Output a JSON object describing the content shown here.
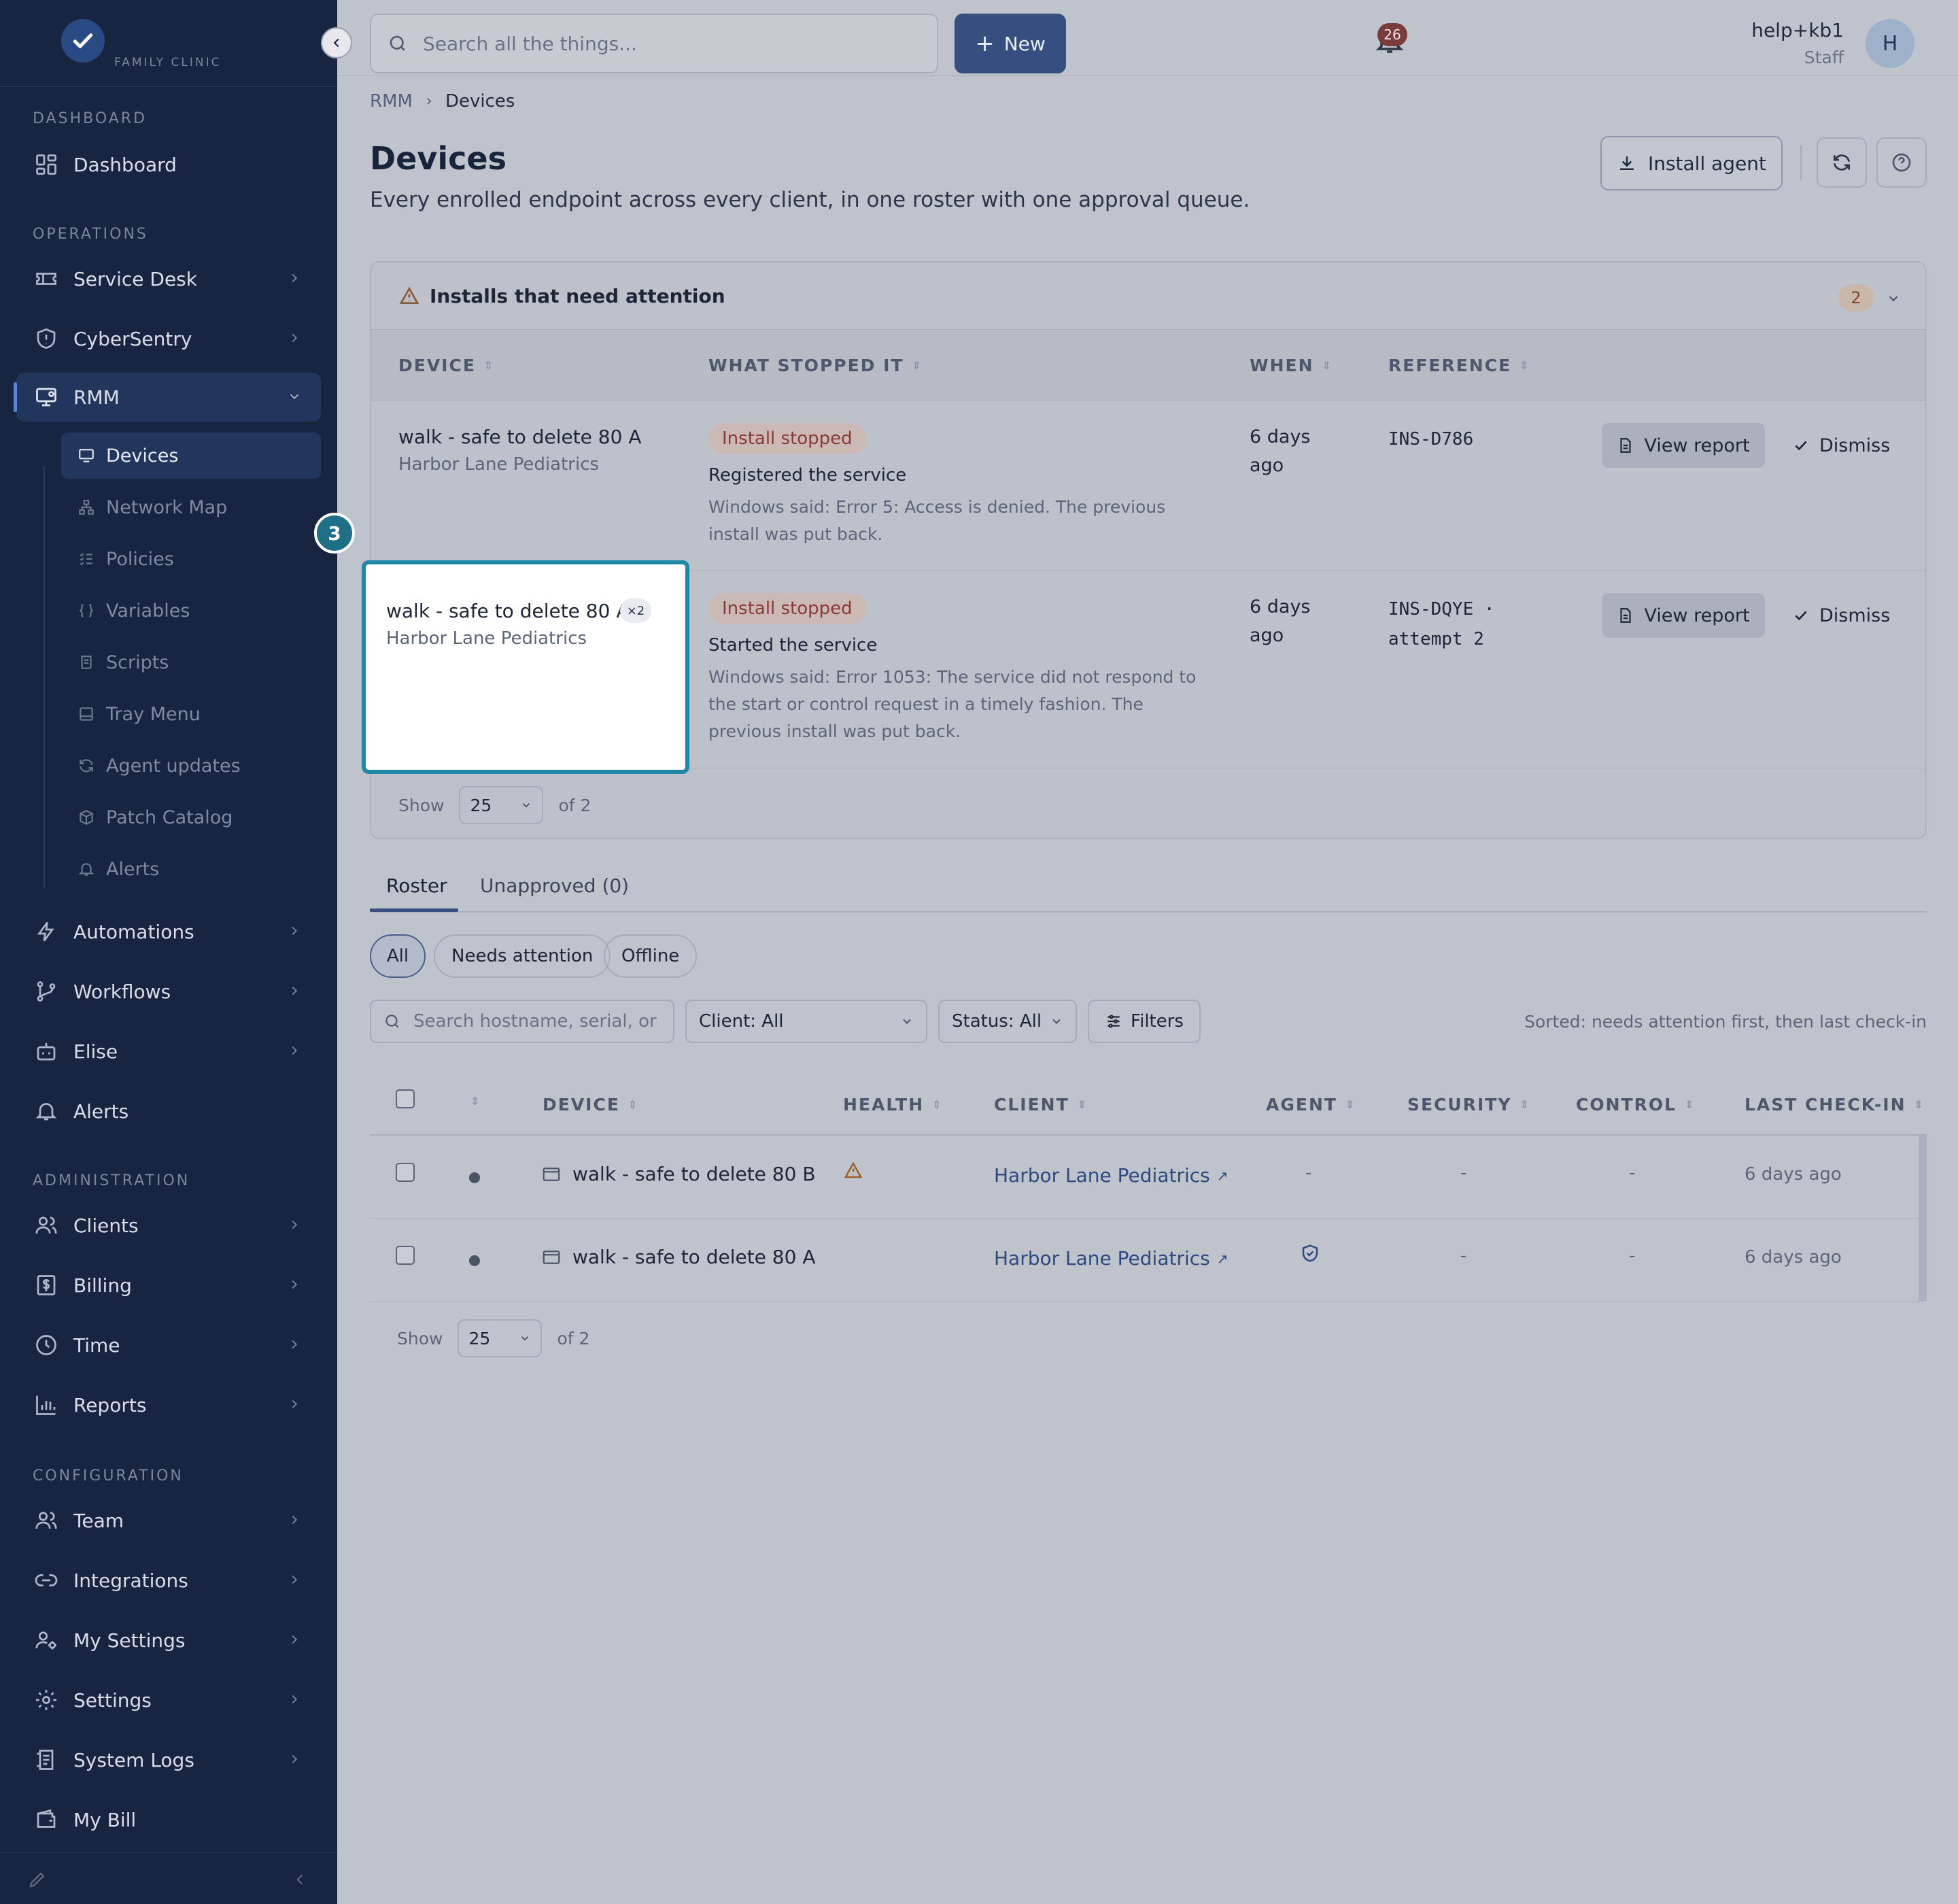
{
  "brand": {
    "name": "FAMILY CLINIC"
  },
  "sidebar": {
    "sections": {
      "dashboard": "DASHBOARD",
      "operations": "OPERATIONS",
      "administration": "ADMINISTRATION",
      "configuration": "CONFIGURATION"
    },
    "items": {
      "dashboard": "Dashboard",
      "service_desk": "Service Desk",
      "cybersentry": "CyberSentry",
      "rmm": "RMM",
      "automations": "Automations",
      "workflows": "Workflows",
      "elise": "Elise",
      "alerts": "Alerts",
      "clients": "Clients",
      "billing": "Billing",
      "time": "Time",
      "reports": "Reports",
      "team": "Team",
      "integrations": "Integrations",
      "my_settings": "My Settings",
      "settings": "Settings",
      "system_logs": "System Logs",
      "my_bill": "My Bill"
    },
    "rmm_sub": {
      "devices": "Devices",
      "network_map": "Network Map",
      "policies": "Policies",
      "variables": "Variables",
      "scripts": "Scripts",
      "tray_menu": "Tray Menu",
      "agent_updates": "Agent updates",
      "patch_catalog": "Patch Catalog",
      "alerts": "Alerts"
    }
  },
  "topbar": {
    "search_placeholder": "Search all the things...",
    "new_label": "New",
    "notifications_count": "26",
    "user_name": "help+kb1",
    "user_role": "Staff",
    "avatar_initial": "H"
  },
  "page": {
    "breadcrumb": [
      "RMM",
      "Devices"
    ],
    "title": "Devices",
    "subtitle": "Every enrolled endpoint across every client, in one roster with one approval queue.",
    "install_agent_label": "Install agent"
  },
  "attention": {
    "title": "Installs that need attention",
    "count": "2",
    "columns": [
      "DEVICE",
      "WHAT STOPPED IT",
      "WHEN",
      "REFERENCE"
    ],
    "rows": [
      {
        "device": "walk - safe to delete 80 A",
        "client": "Harbor Lane Pediatrics",
        "status": "Install stopped",
        "step": "Registered the service",
        "message": "Windows said: Error 5: Access is denied. The previous install was put back.",
        "when": "6 days ago",
        "reference": "INS-D786",
        "view_label": "View report",
        "dismiss_label": "Dismiss"
      },
      {
        "device": "walk - safe to delete 80 A",
        "badge": "×2",
        "client": "Harbor Lane Pediatrics",
        "status": "Install stopped",
        "step": "Started the service",
        "message": "Windows said: Error 1053: The service did not respond to the start or control request in a timely fashion. The previous install was put back.",
        "when": "6 days ago",
        "reference": "INS-DQYE · attempt 2",
        "view_label": "View report",
        "dismiss_label": "Dismiss"
      }
    ],
    "footer": {
      "show": "Show",
      "page_size": "25",
      "of": "of 2"
    },
    "step_marker": "3"
  },
  "tabs": {
    "roster": "Roster",
    "unapproved": "Unapproved (0)"
  },
  "chips": {
    "all": "All",
    "needs_attention": "Needs attention",
    "offline": "Offline"
  },
  "filters": {
    "search_placeholder": "Search hostname, serial, or",
    "client": "Client: All",
    "status": "Status: All",
    "filters_label": "Filters",
    "sorted_note": "Sorted: needs attention first, then last check-in"
  },
  "roster": {
    "columns": [
      "DEVICE",
      "HEALTH",
      "CLIENT",
      "AGENT",
      "SECURITY",
      "CONTROL",
      "LAST CHECK-IN"
    ],
    "rows": [
      {
        "device": "walk - safe to delete 80 B",
        "health": "warning",
        "client": "Harbor Lane Pediatrics",
        "agent": "-",
        "security": "-",
        "control": "-",
        "last_checkin": "6 days ago"
      },
      {
        "device": "walk - safe to delete 80 A",
        "health": "",
        "client": "Harbor Lane Pediatrics",
        "agent": "shield",
        "security": "-",
        "control": "-",
        "last_checkin": "6 days ago"
      }
    ],
    "footer": {
      "show": "Show",
      "page_size": "25",
      "of": "of 2"
    }
  },
  "colors": {
    "sidebar_bg": "#172540",
    "primary": "#364f80",
    "highlight": "#1f88a6",
    "danger_pill": "#8a3a34",
    "link": "#2c4a80"
  }
}
